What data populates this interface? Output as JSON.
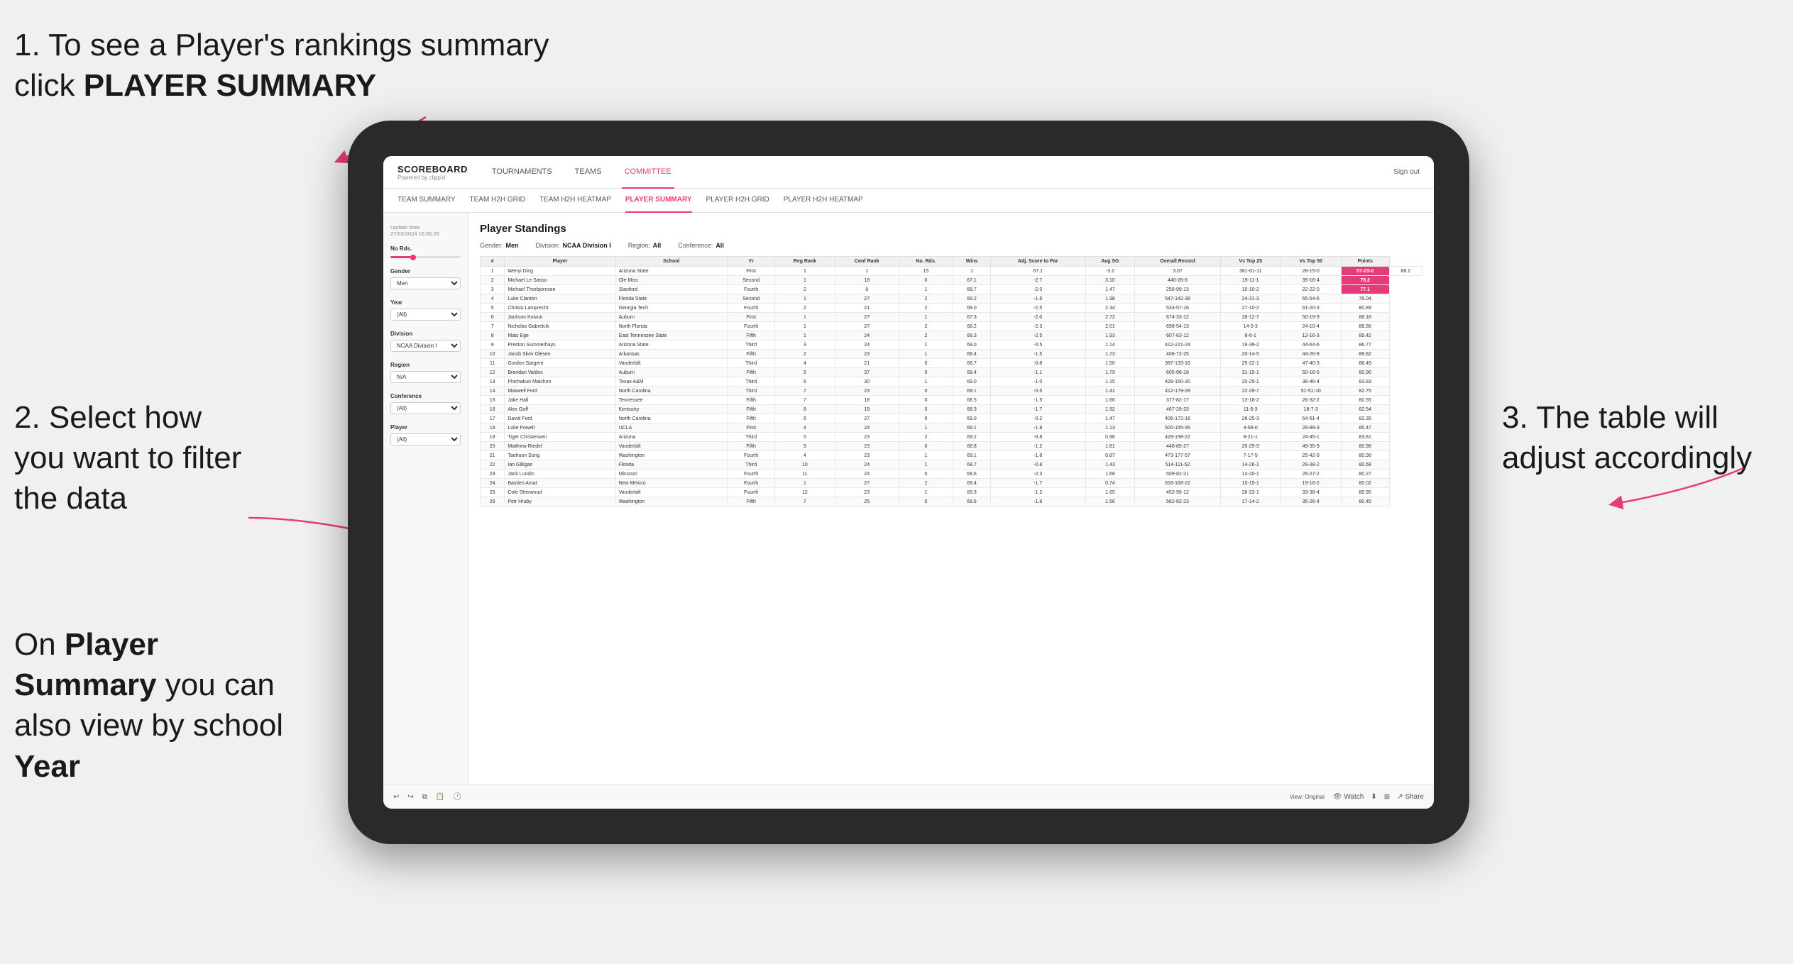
{
  "annotations": {
    "step1": "1. To see a Player's rankings summary click ",
    "step1_bold": "PLAYER SUMMARY",
    "step2": "2. Select how you want to filter the data",
    "step2_sub_prefix": "On ",
    "step2_sub_bold1": "Player Summary",
    "step2_sub_middle": " you can also view by school ",
    "step2_sub_bold2": "Year",
    "step3": "3. The table will adjust accordingly"
  },
  "nav": {
    "logo_title": "SCOREBOARD",
    "logo_sub": "Powered by clipp'd",
    "links": [
      "TOURNAMENTS",
      "TEAMS",
      "COMMITTEE"
    ],
    "sign_out": "Sign out",
    "sub_links": [
      "TEAM SUMMARY",
      "TEAM H2H GRID",
      "TEAM H2H HEATMAP",
      "PLAYER SUMMARY",
      "PLAYER H2H GRID",
      "PLAYER H2H HEATMAP"
    ],
    "active_sub": "PLAYER SUMMARY"
  },
  "sidebar": {
    "update_label": "Update time:",
    "update_time": "27/03/2024 16:56:26",
    "no_rds_label": "No Rds.",
    "gender_label": "Gender",
    "gender_value": "Men",
    "year_label": "Year",
    "year_value": "(All)",
    "division_label": "Division",
    "division_value": "NCAA Division I",
    "region_label": "Region",
    "region_value": "N/A",
    "conference_label": "Conference",
    "conference_value": "(All)",
    "player_label": "Player",
    "player_value": "(All)"
  },
  "table": {
    "title": "Player Standings",
    "filters": {
      "gender_label": "Gender:",
      "gender_value": "Men",
      "division_label": "Division:",
      "division_value": "NCAA Division I",
      "region_label": "Region:",
      "region_value": "All",
      "conference_label": "Conference:",
      "conference_value": "All"
    },
    "headers": [
      "#",
      "Player",
      "School",
      "Yr",
      "Reg Rank",
      "Conf Rank",
      "No. Rds.",
      "Wins",
      "Adj. Score to Par",
      "Avg SG",
      "Overall Record",
      "Vs Top 25",
      "Vs Top 50",
      "Points"
    ],
    "rows": [
      [
        "1",
        "Wenyi Ding",
        "Arizona State",
        "First",
        "1",
        "1",
        "15",
        "1",
        "67.1",
        "-3.2",
        "3.07",
        "381-61-11",
        "28-15-0",
        "57-23-0",
        "88.2"
      ],
      [
        "2",
        "Michael Le Sasso",
        "Ole Miss",
        "Second",
        "1",
        "18",
        "0",
        "67.1",
        "-2.7",
        "3.10",
        "440-26-6",
        "19-11-1",
        "35-16-4",
        "78.2"
      ],
      [
        "3",
        "Michael Thorbjornsen",
        "Stanford",
        "Fourth",
        "2",
        "8",
        "1",
        "68.7",
        "-2.0",
        "1.47",
        "258-99-13",
        "10-10-2",
        "22-22-0",
        "77.1"
      ],
      [
        "4",
        "Luke Clanton",
        "Florida State",
        "Second",
        "1",
        "27",
        "2",
        "68.2",
        "-1.6",
        "1.98",
        "547-142-38",
        "24-31-3",
        "65-54-6",
        "76.04"
      ],
      [
        "5",
        "Christo Lamprecht",
        "Georgia Tech",
        "Fourth",
        "2",
        "21",
        "2",
        "68.0",
        "-2.5",
        "2.34",
        "533-57-16",
        "27-10-2",
        "61-20-3",
        "80.89"
      ],
      [
        "6",
        "Jackson Koivun",
        "Auburn",
        "First",
        "1",
        "27",
        "1",
        "67.3",
        "-2.0",
        "2.72",
        "674-33-12",
        "28-12-7",
        "50-19-9",
        "88.18"
      ],
      [
        "7",
        "Nicholas Gabrelcik",
        "North Florida",
        "Fourth",
        "1",
        "27",
        "2",
        "68.2",
        "-2.3",
        "2.01",
        "698-54-13",
        "14-3-3",
        "24-10-4",
        "88.56"
      ],
      [
        "8",
        "Mats Ege",
        "East Tennessee State",
        "Fifth",
        "1",
        "24",
        "2",
        "68.3",
        "-2.5",
        "1.93",
        "607-63-12",
        "8-6-1",
        "12-16-3",
        "89.42"
      ],
      [
        "9",
        "Preston Summerhays",
        "Arizona State",
        "Third",
        "3",
        "24",
        "1",
        "69.0",
        "-0.5",
        "1.14",
        "412-221-24",
        "19-39-2",
        "44-64-6",
        "86.77"
      ],
      [
        "10",
        "Jacob Skov Olesen",
        "Arkansas",
        "Fifth",
        "2",
        "23",
        "1",
        "68.4",
        "-1.5",
        "1.73",
        "408-72-25",
        "20-14-5",
        "44-26-8",
        "88.82"
      ],
      [
        "11",
        "Gordon Sargent",
        "Vanderbilt",
        "Third",
        "4",
        "21",
        "0",
        "68.7",
        "-0.8",
        "1.50",
        "387-133-16",
        "25-22-1",
        "47-40-3",
        "88.49"
      ],
      [
        "12",
        "Brendan Valdes",
        "Auburn",
        "Fifth",
        "5",
        "37",
        "0",
        "68.4",
        "-1.1",
        "1.79",
        "605-96-18",
        "31-15-1",
        "50-18-5",
        "80.96"
      ],
      [
        "13",
        "Phichakun Maichon",
        "Texas A&M",
        "Third",
        "6",
        "30",
        "1",
        "69.0",
        "-1.0",
        "1.15",
        "428-150-30",
        "20-29-1",
        "38-46-4",
        "83.83"
      ],
      [
        "14",
        "Maxwell Ford",
        "North Carolina",
        "Third",
        "7",
        "23",
        "0",
        "69.1",
        "-0.5",
        "1.41",
        "412-179-28",
        "22-29-7",
        "51-51-10",
        "82.75"
      ],
      [
        "15",
        "Jake Hall",
        "Tennessee",
        "Fifth",
        "7",
        "18",
        "0",
        "68.5",
        "-1.5",
        "1.66",
        "377-82-17",
        "13-18-2",
        "26-32-2",
        "80.55"
      ],
      [
        "16",
        "Alex Goff",
        "Kentucky",
        "Fifth",
        "8",
        "19",
        "0",
        "68.3",
        "-1.7",
        "1.92",
        "467-29-23",
        "11-5-3",
        "18-7-3",
        "82.54"
      ],
      [
        "17",
        "David Ford",
        "North Carolina",
        "Fifth",
        "6",
        "27",
        "0",
        "69.0",
        "-0.2",
        "1.47",
        "406-172-16",
        "26-25-3",
        "54-51-4",
        "82.35"
      ],
      [
        "18",
        "Luke Powell",
        "UCLA",
        "First",
        "4",
        "24",
        "1",
        "69.1",
        "-1.8",
        "1.13",
        "500-155-35",
        "4-58-0",
        "28-89-3",
        "85.47"
      ],
      [
        "19",
        "Tiger Christensen",
        "Arizona",
        "Third",
        "5",
        "23",
        "2",
        "69.2",
        "-0.8",
        "0.96",
        "429-198-22",
        "8-21-1",
        "24-45-1",
        "83.81"
      ],
      [
        "20",
        "Matthew Riedel",
        "Vanderbilt",
        "Fifth",
        "9",
        "23",
        "0",
        "68.8",
        "-1.2",
        "1.61",
        "448-85-27",
        "20-25-9",
        "49-35-9",
        "80.98"
      ],
      [
        "21",
        "Taehoon Song",
        "Washington",
        "Fourth",
        "4",
        "23",
        "1",
        "69.1",
        "-1.8",
        "0.87",
        "473-177-57",
        "7-17-5",
        "25-42-9",
        "80.98"
      ],
      [
        "22",
        "Ian Gilligan",
        "Florida",
        "Third",
        "10",
        "24",
        "1",
        "68.7",
        "-0.8",
        "1.43",
        "514-111-52",
        "14-26-1",
        "29-38-2",
        "80.68"
      ],
      [
        "23",
        "Jack Lundin",
        "Missouri",
        "Fourth",
        "11",
        "24",
        "0",
        "68.6",
        "-2.3",
        "1.68",
        "509-82-21",
        "14-20-1",
        "26-27-2",
        "80.27"
      ],
      [
        "24",
        "Bastien Amat",
        "New Mexico",
        "Fourth",
        "1",
        "27",
        "2",
        "69.4",
        "-1.7",
        "0.74",
        "616-168-22",
        "10-15-1",
        "19-16-2",
        "80.02"
      ],
      [
        "25",
        "Cole Sherwood",
        "Vanderbilt",
        "Fourth",
        "12",
        "23",
        "1",
        "69.3",
        "-1.2",
        "1.65",
        "452-95-12",
        "26-23-1",
        "33-38-4",
        "80.95"
      ],
      [
        "26",
        "Petr Hruby",
        "Washington",
        "Fifth",
        "7",
        "25",
        "0",
        "68.6",
        "-1.8",
        "1.56",
        "562-82-23",
        "17-14-2",
        "35-26-4",
        "80.45"
      ]
    ]
  },
  "toolbar": {
    "view_label": "View: Original",
    "watch_label": "Watch",
    "share_label": "Share"
  }
}
